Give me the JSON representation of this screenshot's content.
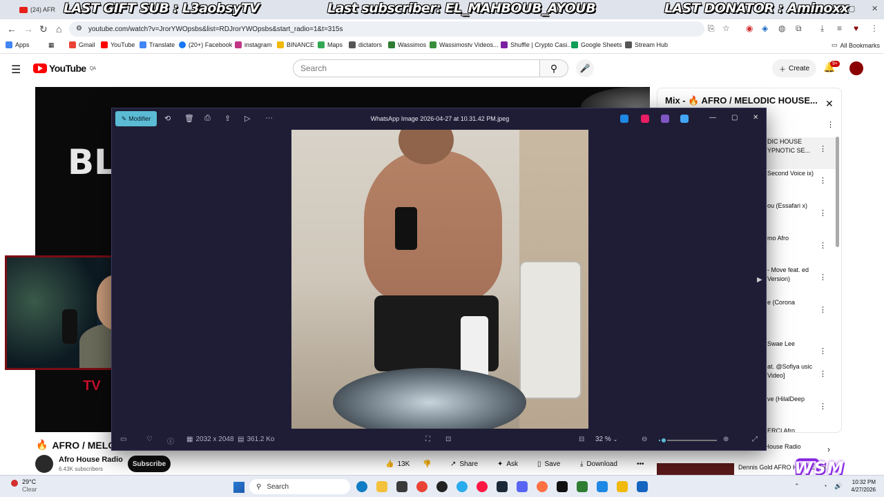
{
  "browser": {
    "tab_label": "(24) AFR",
    "url": "youtube.com/watch?v=JrorYWOpsbs&list=RDJrorYWOpsbs&start_radio=1&t=315s"
  },
  "overlay": {
    "last_gift": "LAST GIFT SUB : L3aobsyTV",
    "last_subscriber": "Last subscriber: EL_MAHBOUB_AYOUB",
    "last_donator": "LAST DONATOR : Aminoxx"
  },
  "bookmarks": [
    {
      "label": "Apps",
      "color": "#4285f4"
    },
    {
      "label": "Gmail",
      "color": "#ea4335"
    },
    {
      "label": "YouTube",
      "color": "#ff0000"
    },
    {
      "label": "Translate",
      "color": "#4285f4"
    },
    {
      "label": "(20+) Facebook",
      "color": "#1877f2"
    },
    {
      "label": "instagram",
      "color": "#c13584"
    },
    {
      "label": "BINANCE",
      "color": "#f0b90b"
    },
    {
      "label": "Maps",
      "color": "#34a853"
    },
    {
      "label": "dictators",
      "color": "#555555"
    },
    {
      "label": "Wassimos",
      "color": "#2e7d32"
    },
    {
      "label": "Wassimostv Videos...",
      "color": "#388e3c"
    },
    {
      "label": "Shuffle | Crypto Casi...",
      "color": "#7b1fa2"
    },
    {
      "label": "Google Sheets",
      "color": "#0f9d58"
    },
    {
      "label": "Stream Hub",
      "color": "#555555"
    }
  ],
  "all_bookmarks": "All Bookmarks",
  "youtube": {
    "logo": "YouTube",
    "region": "QA",
    "search_placeholder": "Search",
    "create": "Create",
    "notif_count": "9+",
    "video_title": "AFRO / MELOD",
    "channel_name": "Afro House Radio",
    "channel_subs": "6.43K subscribers",
    "subscribe": "Subscribe",
    "likes": "13K",
    "share": "Share",
    "ask": "Ask",
    "save": "Save",
    "download": "Download",
    "player_text": "BL"
  },
  "playlist": {
    "title": "Mix - 🔥 AFRO / MELODIC HOUSE...",
    "items": [
      "DIC HOUSE YPNOTIC SE...",
      "Second Voice ix)",
      "ou (Essafari x)",
      "mo Afro",
      "- Move feat. ed Version)",
      "e (Corona",
      "Swae Lee",
      "at. @Sofiya usic Video]",
      "ve (HilalDeep",
      "ERCI Afro"
    ],
    "rec_channel": "ro House Radio",
    "rec_title": "Dennis Gold AFRO HOUSE Mix"
  },
  "photos": {
    "edit": "Modifier",
    "filename": "WhatsApp Image 2026-04-27 at 10.31.42 PM.jpeg",
    "dimensions": "2032 x 2048",
    "filesize": "361.2 Ko",
    "zoom": "32 %",
    "zoom_fraction": 0.08
  },
  "webcam_logo": "TV",
  "taskbar": {
    "temp": "29°C",
    "condition": "Clear",
    "search": "Search",
    "time": "10:32 PM",
    "date": "4/27/2026"
  },
  "watermark": "WSM"
}
